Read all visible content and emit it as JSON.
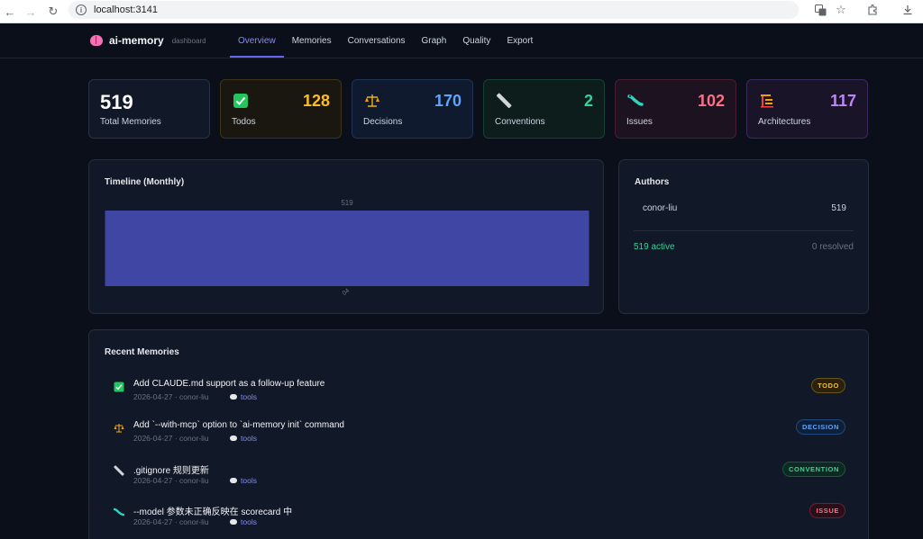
{
  "browser": {
    "url": "localhost:3141"
  },
  "header": {
    "brand_name": "ai-memory",
    "brand_sub": "dashboard",
    "tabs": [
      {
        "label": "Overview",
        "active": true
      },
      {
        "label": "Memories",
        "active": false
      },
      {
        "label": "Conversations",
        "active": false
      },
      {
        "label": "Graph",
        "active": false
      },
      {
        "label": "Quality",
        "active": false
      },
      {
        "label": "Export",
        "active": false
      }
    ]
  },
  "stats": {
    "total": {
      "value": "519",
      "label": "Total Memories"
    },
    "todos": {
      "value": "128",
      "label": "Todos",
      "icon": "check-box-icon",
      "color": "#fbbf24"
    },
    "decisions": {
      "value": "170",
      "label": "Decisions",
      "icon": "scales-icon",
      "color": "#60a5fa"
    },
    "conventions": {
      "value": "2",
      "label": "Conventions",
      "icon": "ruler-icon",
      "color": "#34d399"
    },
    "issues": {
      "value": "102",
      "label": "Issues",
      "icon": "bug-icon",
      "color": "#fb7185"
    },
    "architectures": {
      "value": "117",
      "label": "Architectures",
      "icon": "building-icon",
      "color": "#c084fc"
    }
  },
  "timeline": {
    "title": "Timeline (Monthly)",
    "bar_color": "#4046a4"
  },
  "chart_data": {
    "type": "bar",
    "categories": [
      "04"
    ],
    "values": [
      519
    ],
    "data_labels": [
      "519"
    ],
    "ylim": [
      0,
      519
    ]
  },
  "authors": {
    "title": "Authors",
    "items": [
      {
        "name": "conor-liu",
        "count": "519"
      }
    ],
    "active": "519 active",
    "resolved": "0 resolved"
  },
  "recent": {
    "title": "Recent Memories",
    "items": [
      {
        "title": "Add CLAUDE.md support as a follow-up feature",
        "meta": "2026-04-27 · conor-liu",
        "tag": "tools",
        "badge": "TODO",
        "kind": "todo"
      },
      {
        "title": "Add `--with-mcp` option to `ai-memory init` command",
        "meta": "2026-04-27 · conor-liu",
        "tag": "tools",
        "badge": "DECISION",
        "kind": "decision"
      },
      {
        "title": ".gitignore 规则更新",
        "meta": "2026-04-27 · conor-liu",
        "tag": "tools",
        "badge": "CONVENTION",
        "kind": "convention"
      },
      {
        "title": "--model 参数未正确反映在 scorecard 中",
        "meta": "2026-04-27 · conor-liu",
        "tag": "tools",
        "badge": "ISSUE",
        "kind": "issue"
      }
    ]
  }
}
